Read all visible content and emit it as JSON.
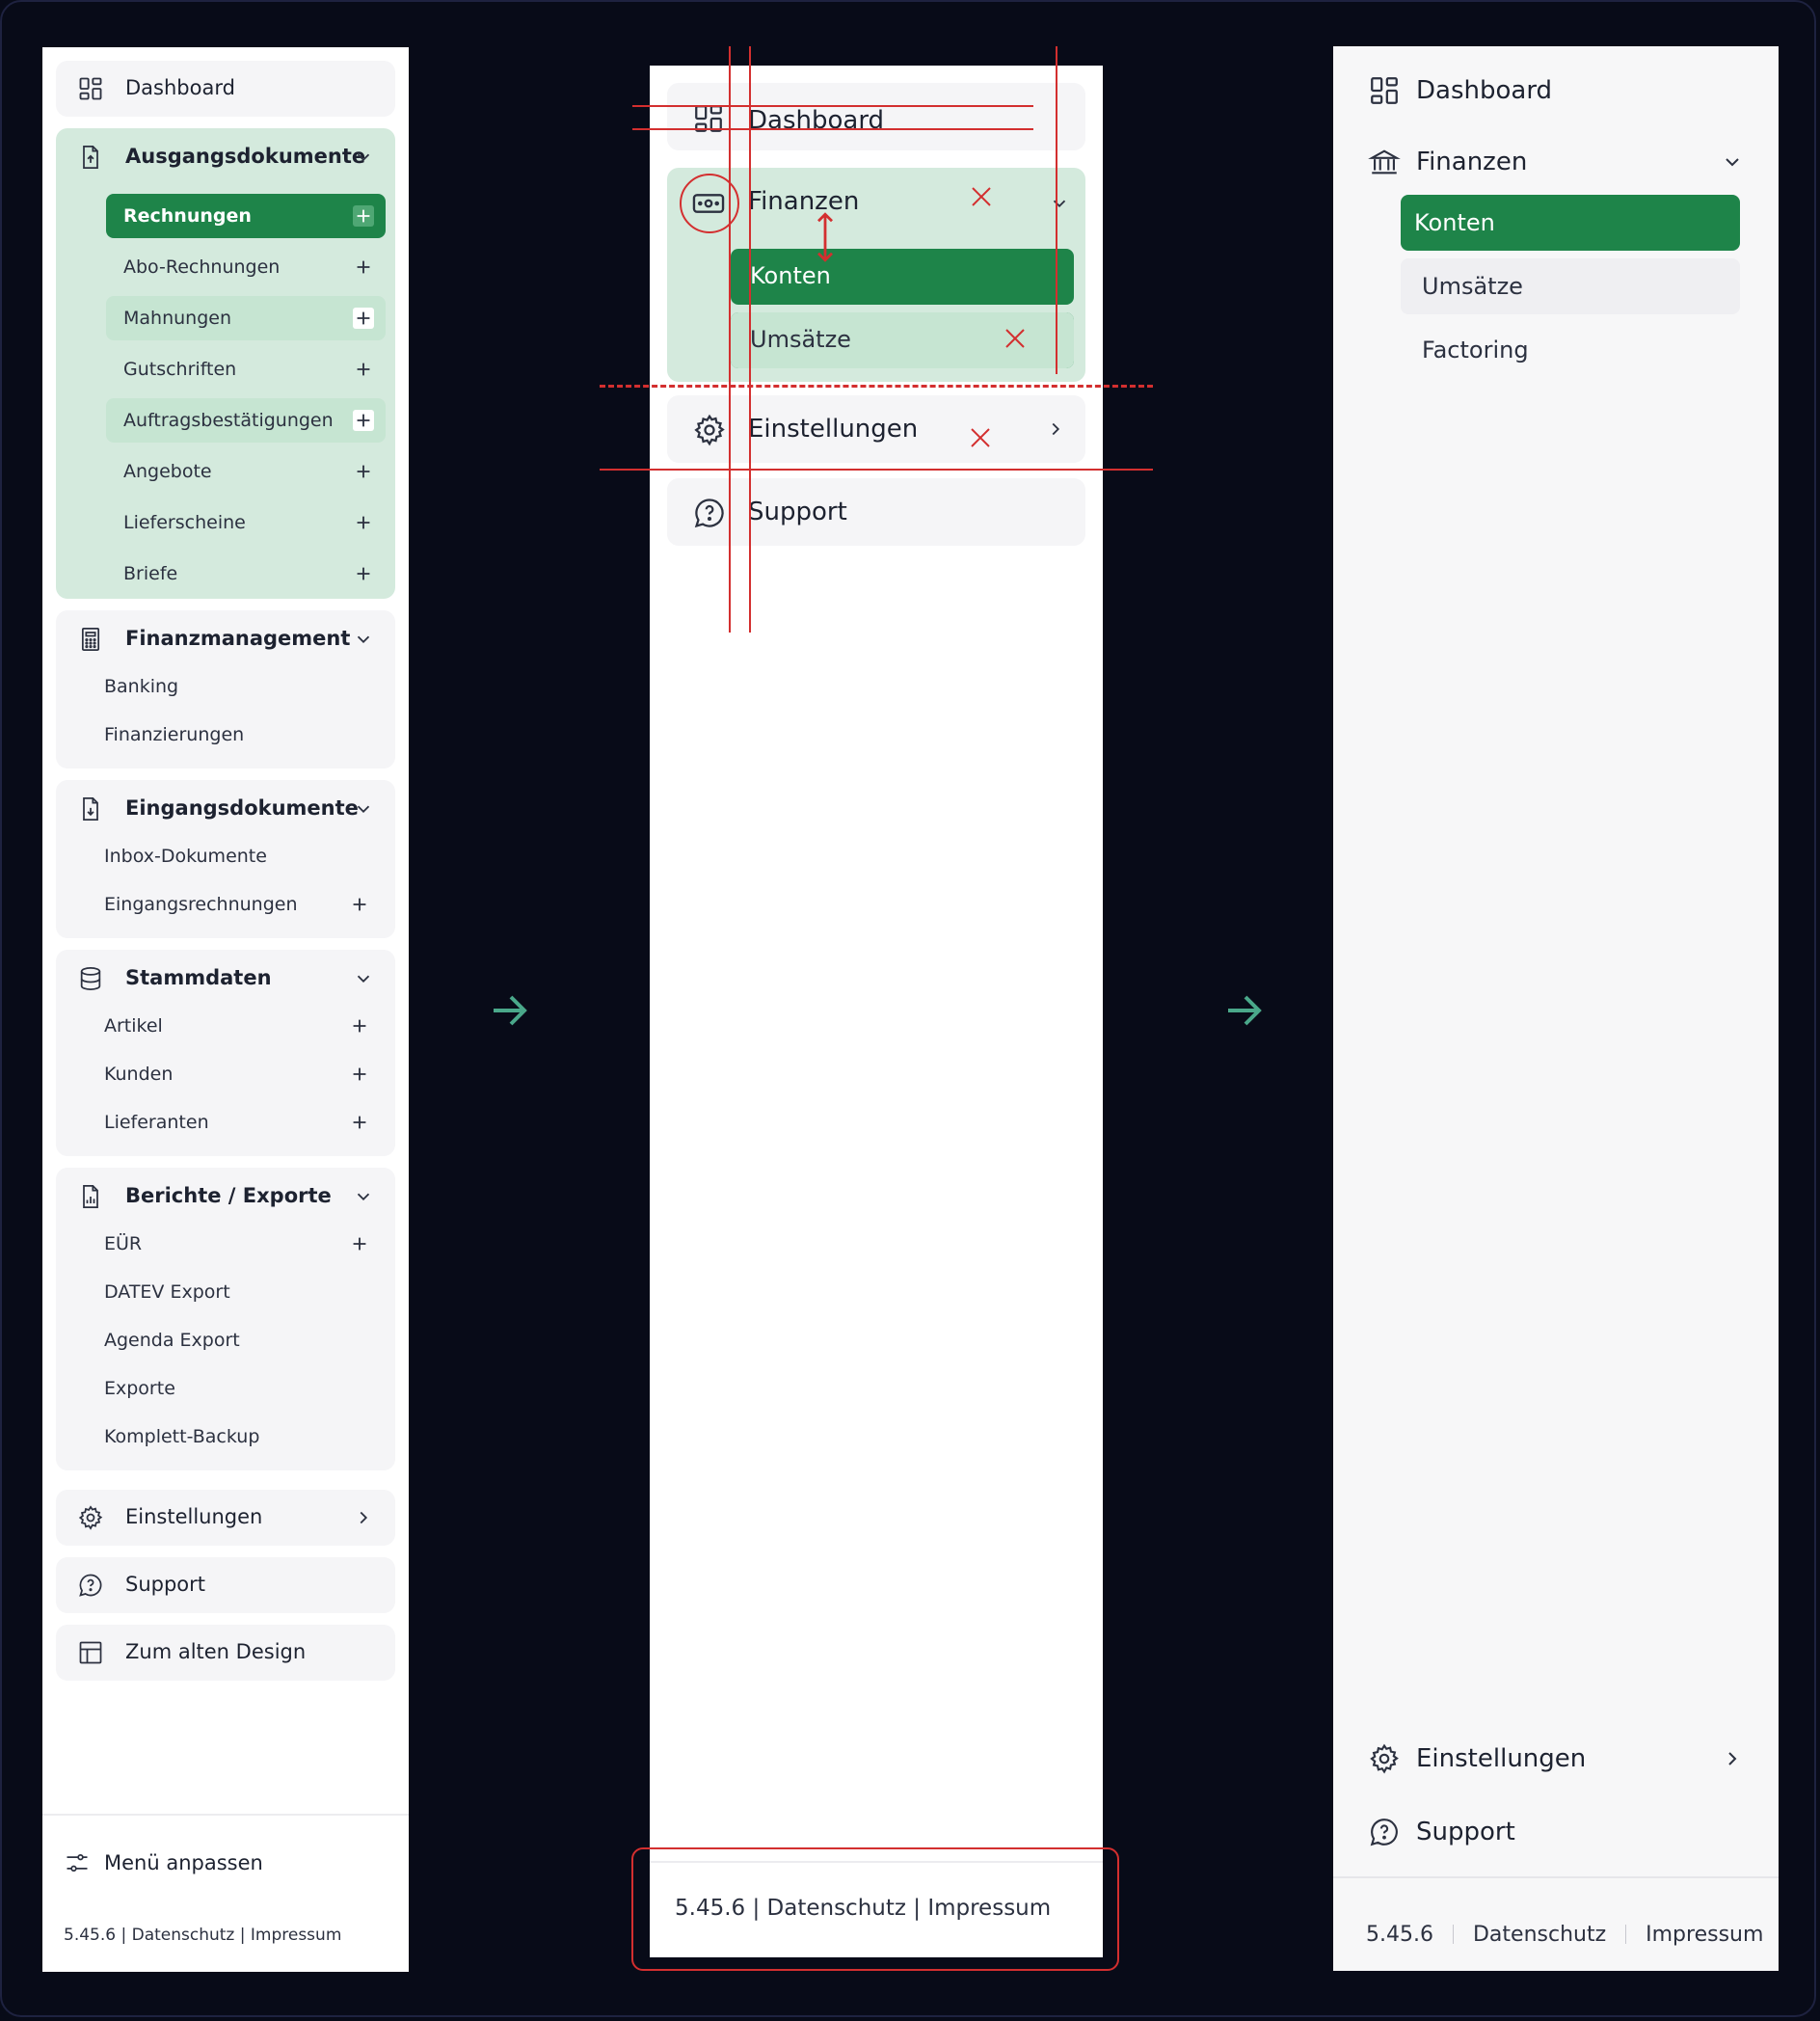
{
  "left_panel": {
    "dashboard": "Dashboard",
    "groups": [
      {
        "title": "Ausgangsdokumente",
        "icon": "document-upload-icon",
        "items": [
          {
            "label": "Rechnungen",
            "plus": true,
            "state": "selected"
          },
          {
            "label": "Abo-Rechnungen",
            "plus": true,
            "state": ""
          },
          {
            "label": "Mahnungen",
            "plus": true,
            "state": "highlight"
          },
          {
            "label": "Gutschriften",
            "plus": true,
            "state": ""
          },
          {
            "label": "Auftragsbestätigungen",
            "plus": true,
            "state": "highlight"
          },
          {
            "label": "Angebote",
            "plus": true,
            "state": ""
          },
          {
            "label": "Lieferscheine",
            "plus": true,
            "state": ""
          },
          {
            "label": "Briefe",
            "plus": true,
            "state": ""
          }
        ]
      },
      {
        "title": "Finanzmanagement",
        "icon": "calculator-icon",
        "items": [
          {
            "label": "Banking",
            "plus": false
          },
          {
            "label": "Finanzierungen",
            "plus": false
          }
        ]
      },
      {
        "title": "Eingangsdokumente",
        "icon": "document-download-icon",
        "items": [
          {
            "label": "Inbox-Dokumente",
            "plus": false
          },
          {
            "label": "Eingangsrechnungen",
            "plus": true
          }
        ]
      },
      {
        "title": "Stammdaten",
        "icon": "database-icon",
        "items": [
          {
            "label": "Artikel",
            "plus": true
          },
          {
            "label": "Kunden",
            "plus": true
          },
          {
            "label": "Lieferanten",
            "plus": true
          }
        ]
      },
      {
        "title": "Berichte / Exporte",
        "icon": "report-icon",
        "items": [
          {
            "label": "EÜR",
            "plus": true
          },
          {
            "label": "DATEV Export",
            "plus": false
          },
          {
            "label": "Agenda Export",
            "plus": false
          },
          {
            "label": "Exporte",
            "plus": false
          },
          {
            "label": "Komplett-Backup",
            "plus": false
          }
        ]
      }
    ],
    "einstellungen": "Einstellungen",
    "support": "Support",
    "alt_design": "Zum alten Design",
    "menu_anpassen": "Menü anpassen",
    "footer": "5.45.6 | Datenschutz | Impressum"
  },
  "middle_panel": {
    "dashboard": "Dashboard",
    "finanzen": "Finanzen",
    "konten": "Konten",
    "umsaetze": "Umsätze",
    "einstellungen": "Einstellungen",
    "support": "Support",
    "footer": "5.45.6 | Datenschutz | Impressum"
  },
  "right_panel": {
    "dashboard": "Dashboard",
    "finanzen": "Finanzen",
    "items": [
      "Konten",
      "Umsätze",
      "Factoring"
    ],
    "einstellungen": "Einstellungen",
    "support": "Support",
    "footer": {
      "version": "5.45.6",
      "privacy": "Datenschutz",
      "imprint": "Impressum"
    }
  },
  "colors": {
    "accent": "#1e8449",
    "active_bg": "#d4eadd",
    "annotation": "#d32f2f",
    "arrow": "#4aa88a"
  }
}
